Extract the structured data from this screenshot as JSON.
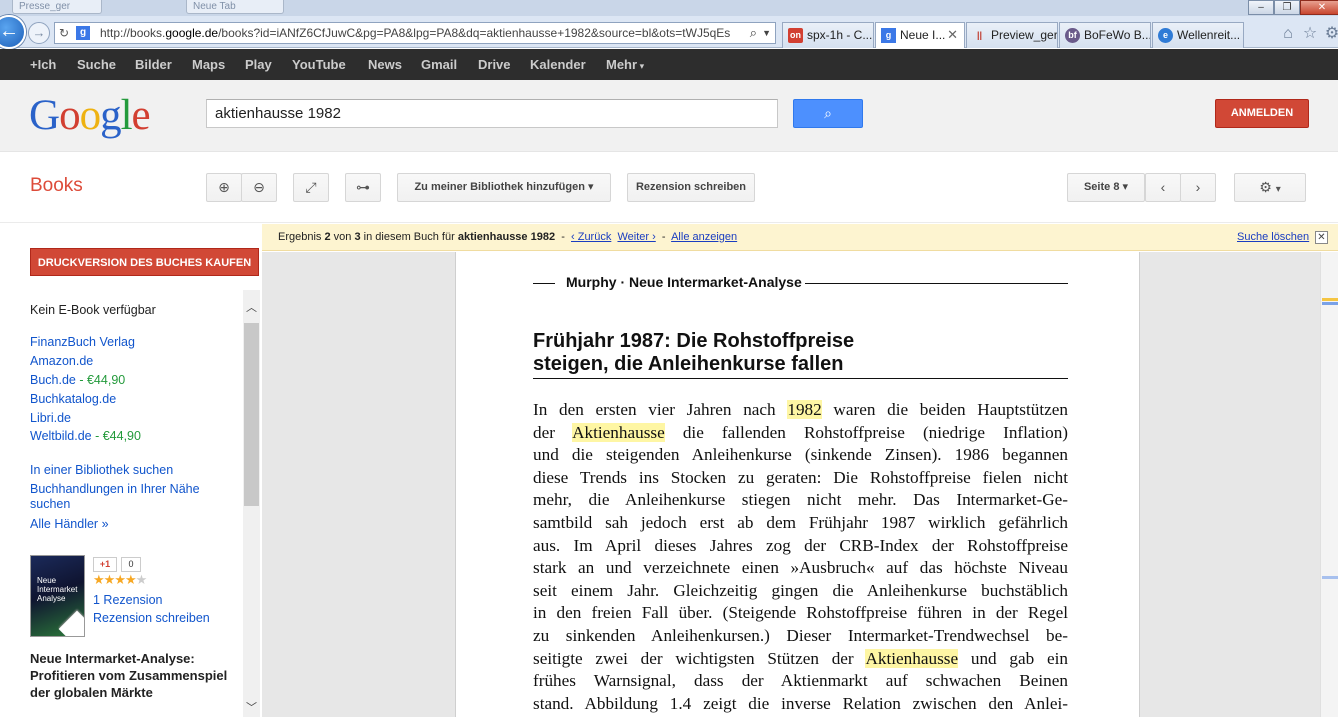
{
  "browser": {
    "ghost_tabs": [
      "Presse_ger",
      "Neue Tab"
    ],
    "url_prefix": "http://books.",
    "url_domain": "google.de",
    "url_rest": "/books?id=iANfZ6CfJuwC&pg=PA8&lpg=PA8&dq=aktienhausse+1982&source=bl&ots=tWJ5qEs",
    "tabs": [
      {
        "label": "spx-1h - C...",
        "icon": "on",
        "color": "#d23f31"
      },
      {
        "label": "Neue I...",
        "icon": "g",
        "color": "#3b78e7"
      },
      {
        "label": "Preview_ger",
        "icon": "||",
        "color": "#c0392b"
      },
      {
        "label": "BoFeWo B...",
        "icon": "bf",
        "color": "#6a5a8a"
      },
      {
        "label": "Wellenreit...",
        "icon": "e",
        "color": "#2f7bd6"
      }
    ]
  },
  "gbar": [
    "+Ich",
    "Suche",
    "Bilder",
    "Maps",
    "Play",
    "YouTube",
    "News",
    "Gmail",
    "Drive",
    "Kalender",
    "Mehr"
  ],
  "header": {
    "search_value": "aktienhausse 1982",
    "signin_label": "ANMELDEN"
  },
  "toolbar": {
    "books_label": "Books",
    "library_label": "Zu meiner Bibliothek hinzufügen",
    "review_label": "Rezension schreiben",
    "page_label": "Seite 8"
  },
  "result": {
    "prefix": "Ergebnis",
    "index": "2",
    "of": "von",
    "total": "3",
    "mid": "in diesem Buch für",
    "query": "aktienhausse 1982",
    "back": "‹ Zurück",
    "next": "Weiter ›",
    "all": "Alle anzeigen",
    "clear": "Suche löschen",
    "sep": "-"
  },
  "sidebar": {
    "buy_label": "DRUCKVERSION DES BUCHES KAUFEN",
    "no_ebook": "Kein E-Book verfügbar",
    "sellers": [
      {
        "name": "FinanzBuch Verlag",
        "price": ""
      },
      {
        "name": "Amazon.de",
        "price": ""
      },
      {
        "name": "Buch.de",
        "price": "€44,90"
      },
      {
        "name": "Buchkatalog.de",
        "price": ""
      },
      {
        "name": "Libri.de",
        "price": ""
      },
      {
        "name": "Weltbild.de",
        "price": "€44,90"
      }
    ],
    "library_search": "In einer Bibliothek suchen",
    "stores_line1": "Buchhandlungen in Ihrer Nähe",
    "stores_line2": "suchen",
    "all_dealers": "Alle Händler »",
    "gplus": "+1",
    "gplus_count": "0",
    "rating": 4,
    "reviews": "1 Rezension",
    "write_review": "Rezension schreiben",
    "cover_text": "Neue Intermarket Analyse",
    "book_title": "Neue Intermarket-Analyse: Profitieren vom Zusammenspiel der globalen Märkte"
  },
  "page": {
    "running_head": "Murphy · Neue Intermarket-Analyse",
    "title_line1": "Frühjahr 1987: Die Rohstoffpreise",
    "title_line2": "steigen, die Anleihenkurse fallen",
    "lines": [
      [
        {
          "t": "In den ersten vier Jahren nach "
        },
        {
          "t": "1982",
          "h": true
        },
        {
          "t": " waren die beiden Hauptstützen"
        }
      ],
      [
        {
          "t": "der "
        },
        {
          "t": "Aktienhausse",
          "h": true
        },
        {
          "t": " die fallenden Rohstoffpreise (niedrige Inflation)"
        }
      ],
      [
        {
          "t": "und die steigenden Anleihenkurse (sinkende Zinsen). 1986 begannen"
        }
      ],
      [
        {
          "t": "diese Trends ins Stocken zu geraten: Die Rohstoffpreise fielen nicht"
        }
      ],
      [
        {
          "t": "mehr, die Anleihenkurse stiegen nicht mehr. Das Intermarket-Ge-"
        }
      ],
      [
        {
          "t": "samtbild sah jedoch erst ab dem Frühjahr 1987 wirklich gefährlich"
        }
      ],
      [
        {
          "t": "aus. Im April dieses Jahres zog der CRB-Index der Rohstoffpreise"
        }
      ],
      [
        {
          "t": "stark an und verzeichnete einen »Ausbruch« auf das höchste Niveau"
        }
      ],
      [
        {
          "t": "seit einem Jahr. Gleichzeitig gingen die Anleihenkurse buchstäblich"
        }
      ],
      [
        {
          "t": "in den freien Fall über. (Steigende Rohstoffpreise führen in der Regel"
        }
      ],
      [
        {
          "t": "zu sinkenden Anleihenkursen.) Dieser Intermarket-Trendwechsel be-"
        }
      ],
      [
        {
          "t": "seitigte zwei der wichtigsten Stützen der "
        },
        {
          "t": "Aktienhausse",
          "h": true
        },
        {
          "t": " und gab ein"
        }
      ],
      [
        {
          "t": "frühes Warnsignal, dass der Aktienmarkt auf schwachen Beinen"
        }
      ],
      [
        {
          "t": "stand. Abbildung 1.4 zeigt die inverse Relation zwischen den Anlei-"
        }
      ]
    ]
  }
}
